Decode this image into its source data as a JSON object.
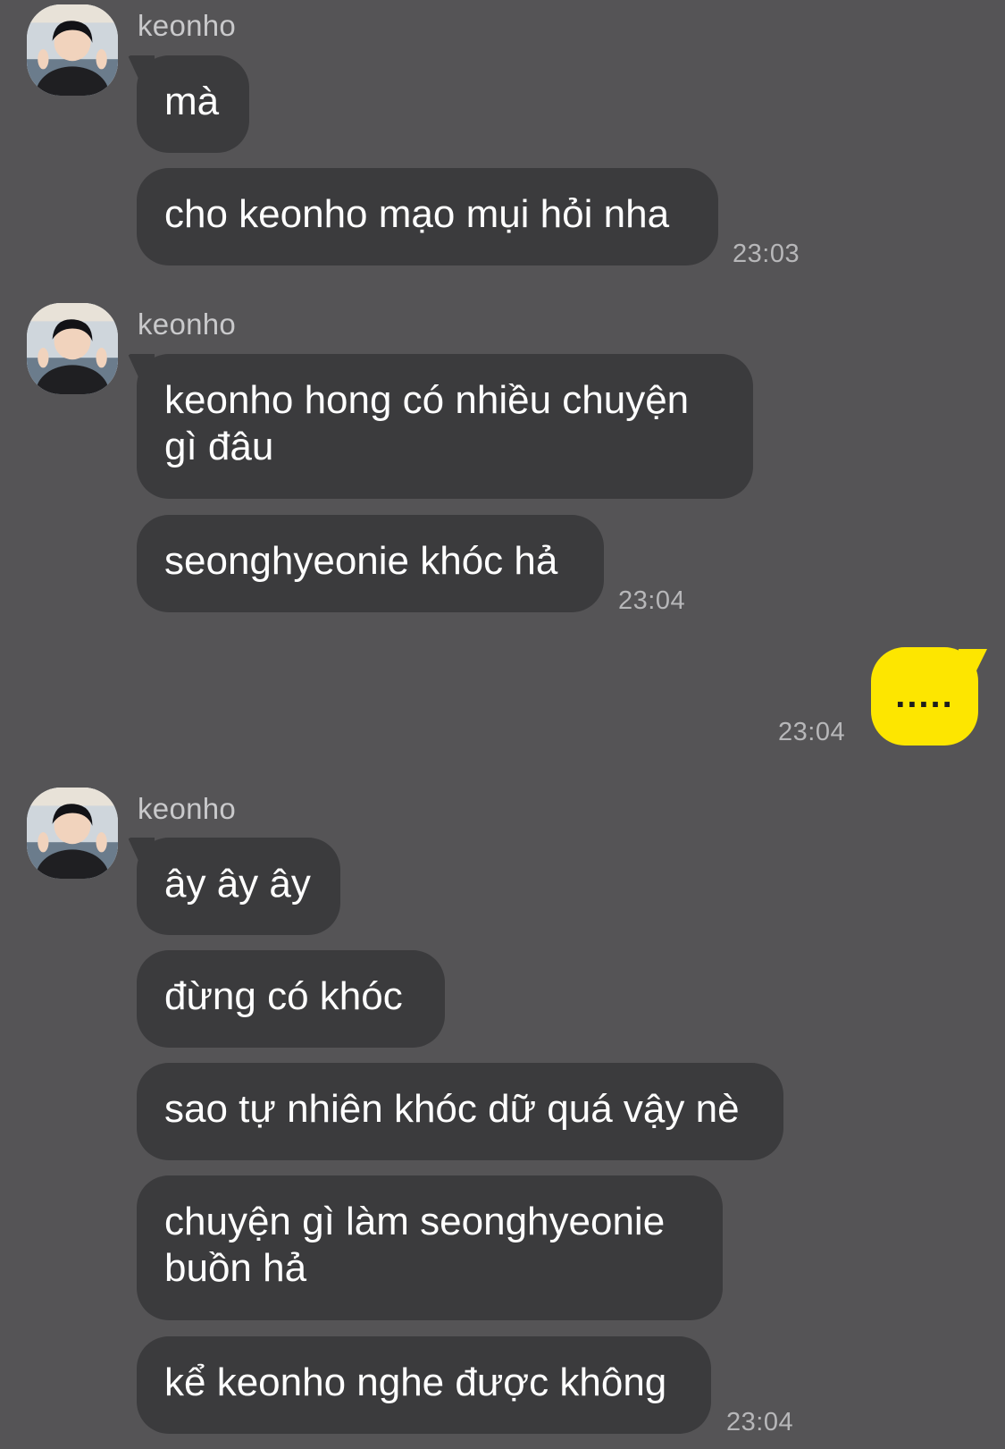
{
  "groups": [
    {
      "sender": "keonho",
      "messages": [
        "mà",
        "cho keonho mạo mụi hỏi nha"
      ],
      "time": "23:03"
    },
    {
      "sender": "keonho",
      "messages": [
        "keonho hong có nhiều chuyện\ngì đâu",
        "seonghyeonie khóc hả"
      ],
      "time": "23:04"
    },
    {
      "sender": "keonho",
      "messages": [
        "ây ây ây",
        "đừng có khóc",
        "sao tự nhiên khóc dữ quá vậy nè",
        "chuyện gì làm seonghyeonie\nbuồn hả",
        "kể keonho nghe được không"
      ],
      "time": "23:04"
    }
  ],
  "my_message": {
    "text": ".....",
    "time": "23:04"
  },
  "colors": {
    "background": "#555456",
    "incoming_bubble": "#3b3b3d",
    "outgoing_bubble": "#fde600"
  },
  "icons": {
    "avatar": "profile-photo"
  }
}
